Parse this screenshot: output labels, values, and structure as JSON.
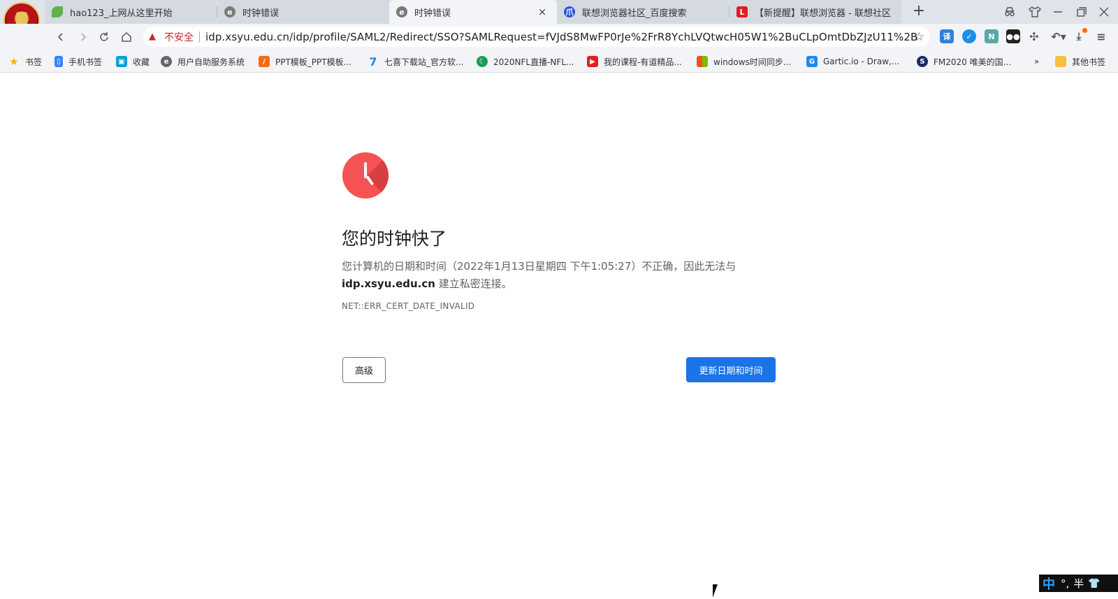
{
  "colors": {
    "accent": "#1a73e8",
    "error": "#f55353",
    "insecure": "#c62828"
  },
  "tabs": [
    {
      "title": "hao123_上网从这里开始",
      "icon": "leaf-icon",
      "active": false
    },
    {
      "title": "时钟错误",
      "icon": "globe-icon",
      "active": false
    },
    {
      "title": "时钟错误",
      "icon": "globe-icon",
      "active": true,
      "close": "×"
    },
    {
      "title": "联想浏览器社区_百度搜索",
      "icon": "paw-icon",
      "active": false
    },
    {
      "title": "【新提醒】联想浏览器 - 联想社区",
      "icon": "l-icon",
      "active": false
    }
  ],
  "new_tab": "+",
  "toolbar": {
    "insecure_label": "不安全",
    "url": "idp.xsyu.edu.cn/idp/profile/SAML2/Redirect/SSO?SAMLRequest=fVJdS8MwFP0rJe%2FrR8YchLVQtwcH05W1%2BuCLpOmtDbZJzU11%2B%2F..."
  },
  "bookmarks": [
    {
      "label": "书签",
      "icon": "star-icon"
    },
    {
      "label": "手机书签",
      "icon": "phone-icon"
    },
    {
      "label": "收藏",
      "icon": "tv-icon"
    },
    {
      "label": "用户自助服务系统",
      "icon": "globe-icon"
    },
    {
      "label": "PPT模板_PPT模板...",
      "icon": "ppt-icon"
    },
    {
      "label": "七喜下载站_官方软...",
      "icon": "seven-icon"
    },
    {
      "label": "2020NFL直播-NFL...",
      "icon": "nfl-icon"
    },
    {
      "label": "我的课程-有道精品...",
      "icon": "youdao-icon"
    },
    {
      "label": "windows时间同步...",
      "icon": "windows-icon"
    },
    {
      "label": "Gartic.io - Draw,...",
      "icon": "gartic-icon"
    },
    {
      "label": "FM2020 唯美的国...",
      "icon": "fm-icon"
    },
    {
      "label": "»",
      "icon": "more-icon"
    },
    {
      "label": "其他书签",
      "icon": "folder-icon"
    }
  ],
  "error_page": {
    "heading": "您的时钟快了",
    "message_part1": "您计算机的日期和时间（2022年1月13日星期四 下午1:05:27）不正确，因此无法与",
    "domain": "idp.xsyu.edu.cn",
    "message_part2": " 建立私密连接。",
    "error_code": "NET::ERR_CERT_DATE_INVALID",
    "advanced_button": "高级",
    "update_button": "更新日期和时间"
  },
  "ime": {
    "mode": "中",
    "punctuation": "°,",
    "width": "半"
  }
}
